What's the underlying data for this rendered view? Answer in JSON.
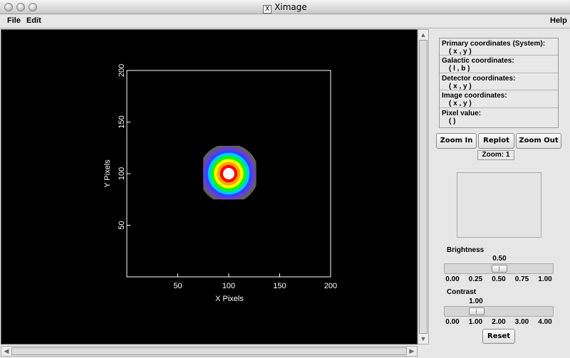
{
  "window": {
    "title": "Ximage"
  },
  "menubar": {
    "file": "File",
    "edit": "Edit",
    "help": "Help"
  },
  "plot": {
    "xlabel": "X Pixels",
    "ylabel": "Y Pixels",
    "xticks": [
      "50",
      "100",
      "150",
      "200"
    ],
    "yticks": [
      "50",
      "100",
      "150",
      "200"
    ]
  },
  "chart_data": {
    "type": "heatmap",
    "xlabel": "X Pixels",
    "ylabel": "Y Pixels",
    "xlim": [
      0,
      200
    ],
    "ylim": [
      0,
      200
    ],
    "image_extent": {
      "x": [
        75,
        127
      ],
      "y": [
        75,
        127
      ]
    },
    "source_center": [
      100,
      100
    ],
    "colormap_rings": [
      "#ffffff",
      "#ff0000",
      "#ffa500",
      "#ffff00",
      "#00ff00",
      "#00c8ff",
      "#3344ff",
      "#6a40c8",
      "#606060"
    ]
  },
  "coords": {
    "primary_label": "Primary coordinates (System):",
    "primary_value": "( x , y )",
    "galactic_label": "Galactic coordinates:",
    "galactic_value": "( l , b )",
    "detector_label": "Detector coordinates:",
    "detector_value": "( x , y )",
    "image_label": "Image coordinates:",
    "image_value": "( x , y )",
    "pixel_label": "Pixel value:",
    "pixel_value": "( )"
  },
  "zoom": {
    "in_label": "Zoom In",
    "replot_label": "Replot",
    "out_label": "Zoom Out",
    "level_text": "Zoom: 1"
  },
  "brightness": {
    "label": "Brightness",
    "value": "0.50",
    "fraction": 0.5,
    "ticks": [
      "0.00",
      "0.25",
      "0.50",
      "0.75",
      "1.00"
    ]
  },
  "contrast": {
    "label": "Contrast",
    "value": "1.00",
    "fraction": 0.25,
    "ticks": [
      "0.00",
      "1.00",
      "2.00",
      "3.00",
      "4.00"
    ]
  },
  "reset_label": "Reset"
}
